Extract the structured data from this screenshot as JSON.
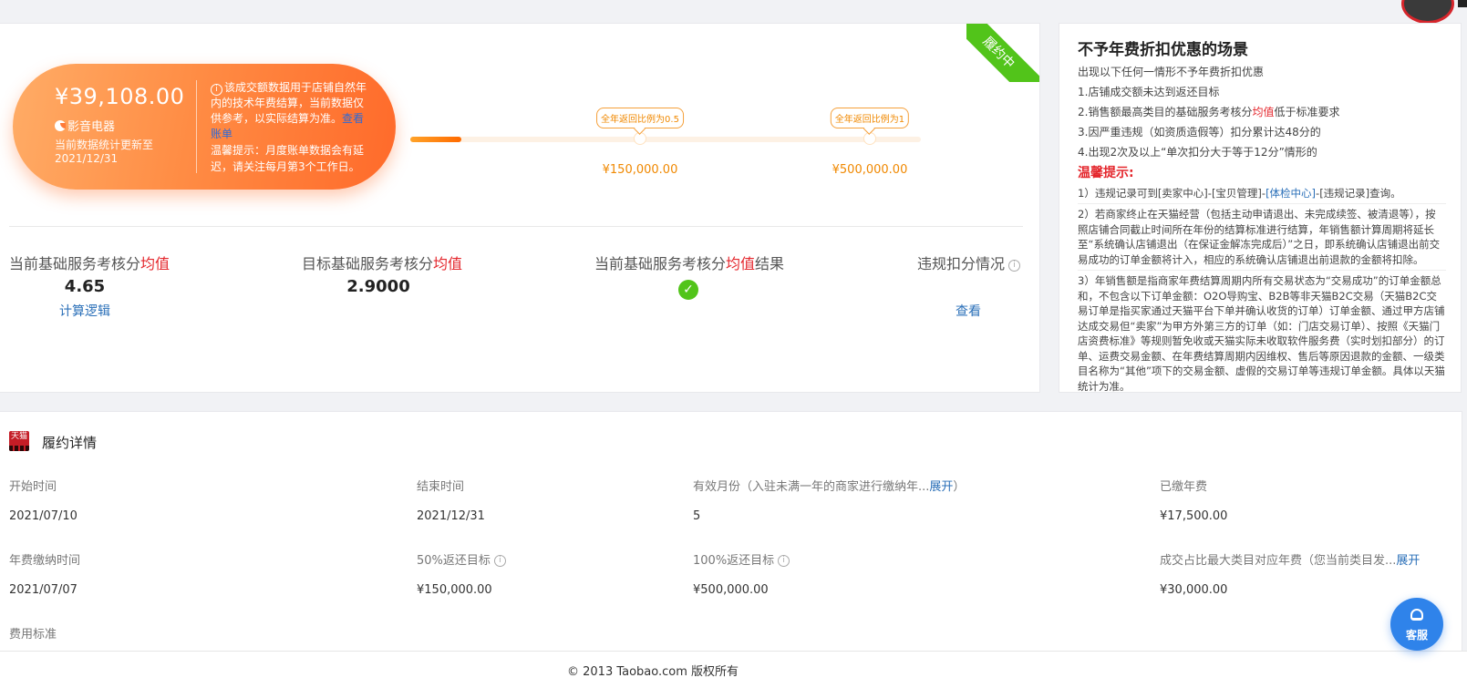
{
  "status_ribbon": "履约中",
  "summary": {
    "amount": "¥39,108.00",
    "shop_name": "影音电器",
    "update_line1": "当前数据统计更新至",
    "update_line2": "2021/12/31",
    "note_text": "该成交额数据用于店铺自然年内的技术年费结算，当前数据仅供参考，以实际结算为准。",
    "note_link": "查看账单",
    "tip_text": "温馨提示：月度账单数据会有延迟，请关注每月第3个工作日。"
  },
  "progress": {
    "fill_fraction": 0.1,
    "markers": [
      {
        "bubble": "全年返回比例为0.5",
        "value": "¥150,000.00",
        "fraction": 0.45
      },
      {
        "bubble": "全年返回比例为1",
        "value": "¥500,000.00",
        "fraction": 0.9
      }
    ]
  },
  "metrics": {
    "current_label": "当前基础服务考核分",
    "current_label_red": "均值",
    "current_value": "4.65",
    "current_link": "计算逻辑",
    "target_label": "目标基础服务考核分",
    "target_label_red": "均值",
    "target_value": "2.9000",
    "result_label": "当前基础服务考核分",
    "result_label_red": "均值",
    "result_label_tail": "结果",
    "violation_label": "违规扣分情况",
    "violation_link": "查看"
  },
  "no_discount": {
    "title": "不予年费折扣优惠的场景",
    "subtitle": "出现以下任何一情形不予年费折扣优惠",
    "item1": "1.店铺成交额未达到返还目标",
    "item2_pre": "2.销售额最高类目的基础服务考核分",
    "item2_red": "均值",
    "item2_post": "低于标准要求",
    "item3": "3.因严重违规（如资质造假等）扣分累计达48分的",
    "item4": "4.出现2次及以上“单次扣分大于等于12分”情形的",
    "warn_title": "温馨提示:",
    "para1_pre": "1）违规记录可到[卖家中心]-[宝贝管理]-",
    "para1_link": "[体检中心]",
    "para1_post": "-[违规记录]查询。",
    "para2": "2）若商家终止在天猫经营（包括主动申请退出、未完成续签、被清退等），按照店铺合同截止时间所在年份的结算标准进行结算，年销售额计算周期将延长至“系统确认店铺退出（在保证金解冻完成后）”之日，即系统确认店铺退出前交易成功的订单金额将计入，相应的系统确认店铺退出前退款的金额将扣除。",
    "para3": "3）年销售额是指商家年费结算周期内所有交易状态为“交易成功”的订单金额总和，不包含以下订单金额：O2O导购宝、B2B等非天猫B2C交易（天猫B2C交易订单是指买家通过天猫平台下单并确认收货的订单）订单金额、通过甲方店铺达成交易但“卖家”为甲方外第三方的订单（如：门店交易订单）、按照《天猫门店资费标准》等规则暂免收或天猫实际未收取软件服务费（实时划扣部分）的订单、运费交易金额、在年费结算周期内因维权、售后等原因退款的金额、一级类目名称为“其他”项下的交易金额、虚假的交易订单等违规订单金额。具体以天猫统计为准。"
  },
  "detail": {
    "logo_text": "天猫",
    "title": "履约详情",
    "start_label": "开始时间",
    "start_value": "2021/07/10",
    "end_label": "结束时间",
    "end_value": "2021/12/31",
    "months_label": "有效月份（入驻未满一年的商家进行缴纳年...",
    "months_link": "展开",
    "months_label_tail": "）",
    "months_value": "5",
    "paid_label": "已缴年费",
    "paid_value": "¥17,500.00",
    "pay_time_label": "年费缴纳时间",
    "pay_time_value": "2021/07/07",
    "target50_label": "50%返还目标",
    "target50_value": "¥150,000.00",
    "target100_label": "100%返还目标",
    "target100_value": "¥500,000.00",
    "max_cat_label": "成交占比最大类目对应年费（您当前类目发...",
    "max_cat_link": "展开",
    "max_cat_value": "¥30,000.00",
    "fee_std_label": "费用标准"
  },
  "footer": {
    "text": "© 2013 Taobao.com 版权所有"
  },
  "customer_service": {
    "label": "客服"
  },
  "colors": {
    "accent_orange": "#ff7a38",
    "success_green": "#52c41a",
    "link_blue": "#2a6fb8",
    "alert_red": "#e4262c"
  }
}
